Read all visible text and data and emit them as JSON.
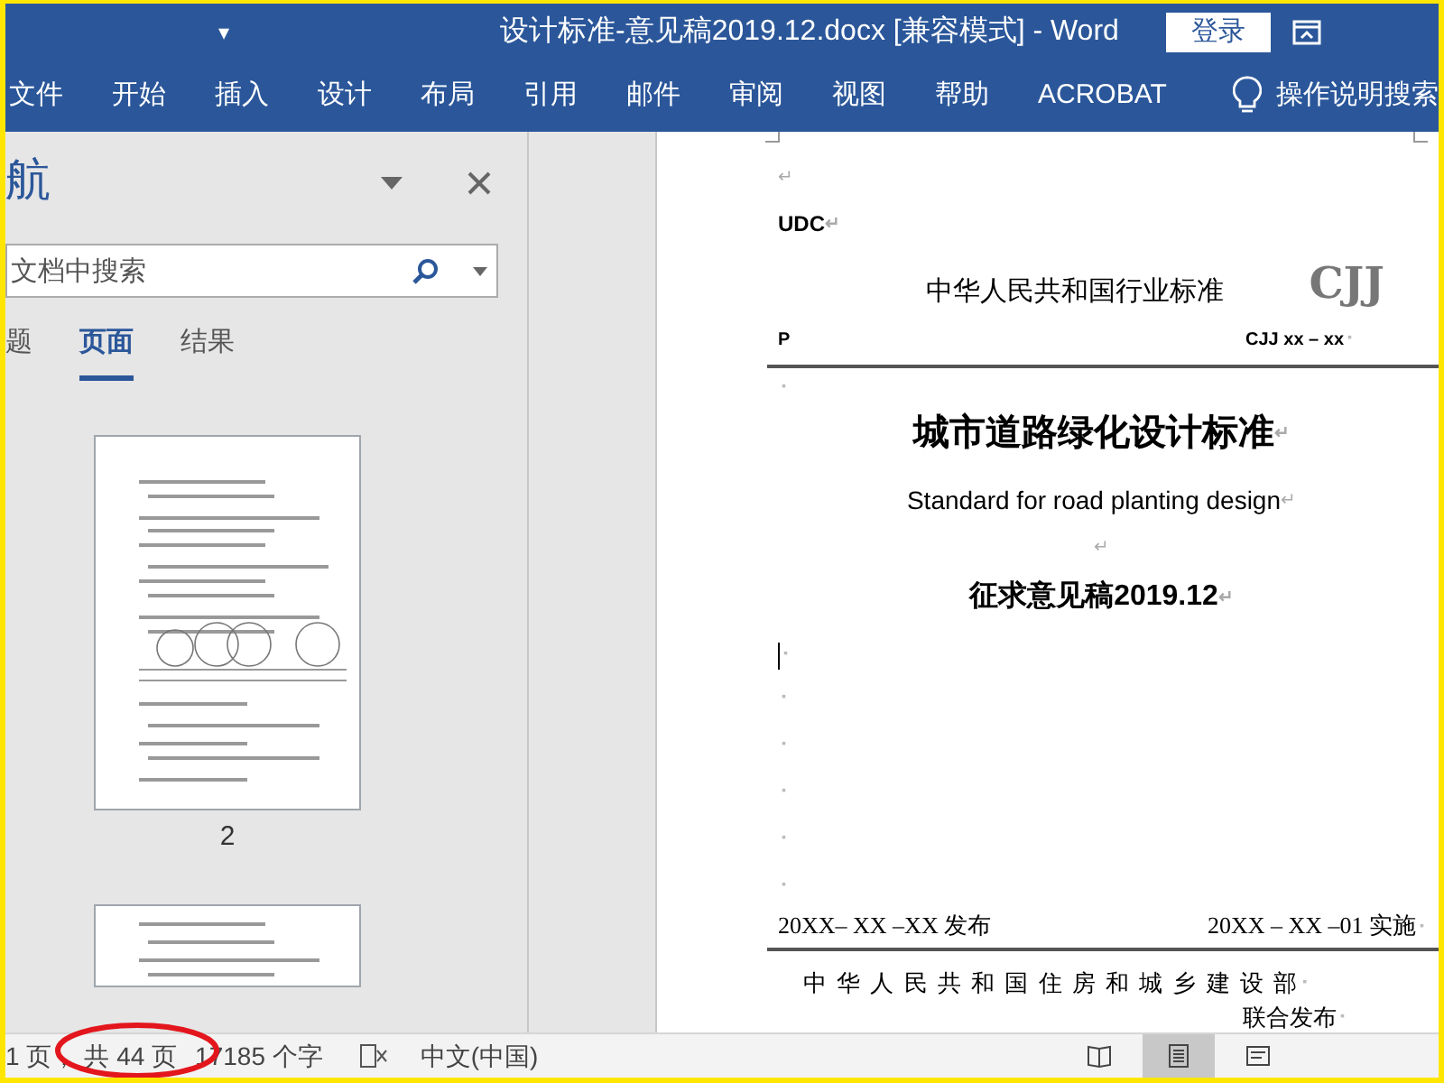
{
  "title_bar": {
    "quick_access": "▾",
    "title": "设计标准-意见稿2019.12.docx [兼容模式] - Word",
    "sign_in": "登录"
  },
  "ribbon_tabs": [
    {
      "label": "文件",
      "selected": false
    },
    {
      "label": "开始",
      "selected": false
    },
    {
      "label": "插入",
      "selected": false
    },
    {
      "label": "设计",
      "selected": false
    },
    {
      "label": "布局",
      "selected": false
    },
    {
      "label": "引用",
      "selected": false
    },
    {
      "label": "邮件",
      "selected": false
    },
    {
      "label": "审阅",
      "selected": false
    },
    {
      "label": "视图",
      "selected": false
    },
    {
      "label": "帮助",
      "selected": false
    },
    {
      "label": "ACROBAT",
      "selected": false
    }
  ],
  "tell_me": "操作说明搜索",
  "nav_pane": {
    "title": "航",
    "search_placeholder": "文档中搜索",
    "tabs": [
      {
        "label": "题",
        "selected": false
      },
      {
        "label": "页面",
        "selected": true
      },
      {
        "label": "结果",
        "selected": false
      }
    ],
    "thumbnails": [
      {
        "kind": "full",
        "label": "2"
      },
      {
        "kind": "partial"
      }
    ]
  },
  "document": {
    "lines": [
      {
        "kind": "blank",
        "mark": "↵"
      },
      {
        "kind": "udc",
        "text": "UDC",
        "mark": "↵"
      },
      {
        "kind": "header",
        "text": "中华人民共和国行业标准",
        "logo": "CJJ"
      },
      {
        "kind": "code",
        "left": "P",
        "right": "CJJ xx – xx",
        "mark": "▪"
      },
      {
        "kind": "rule"
      },
      {
        "kind": "small",
        "mark": "▪"
      },
      {
        "kind": "title",
        "text": "城市道路绿化设计标准",
        "mark": "↵"
      },
      {
        "kind": "subtitle",
        "text": "Standard for road planting design",
        "mark": "↵"
      },
      {
        "kind": "spacer",
        "mark": "↵"
      },
      {
        "kind": "draft",
        "text": "征求意见稿2019.12",
        "mark": "↵"
      },
      {
        "kind": "cursor",
        "mark": "▪"
      },
      {
        "kind": "blank",
        "mark": "▪"
      },
      {
        "kind": "blank",
        "mark": "▪"
      },
      {
        "kind": "blank",
        "mark": "▪"
      },
      {
        "kind": "blank",
        "mark": "▪"
      },
      {
        "kind": "blank",
        "mark": "▪"
      },
      {
        "kind": "date",
        "left": "20XX– XX –XX 发布",
        "right": "20XX – XX –01 实施",
        "mark": "▪"
      },
      {
        "kind": "rule"
      },
      {
        "kind": "org",
        "text": "中 华 人 民 共 和 国 住 房 和 城 乡 建 设 部",
        "mark": "▪"
      },
      {
        "kind": "joint",
        "text": "联合发布",
        "mark": "▪"
      }
    ]
  },
  "status_bar": {
    "items": [
      "1 页，",
      "共 44 页",
      "17185 个字"
    ],
    "language": "中文(中国)",
    "views": [
      {
        "selected": false
      },
      {
        "selected": true
      },
      {
        "selected": false
      }
    ],
    "annotation": true
  }
}
